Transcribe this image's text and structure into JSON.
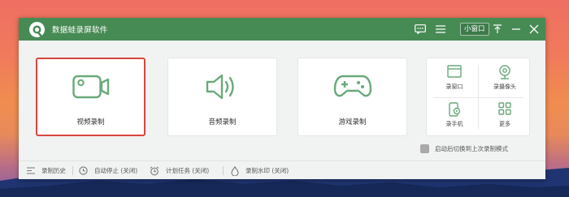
{
  "app": {
    "title": "数据蛙录屏软件"
  },
  "titlebar": {
    "mini_window_label": "小窗口",
    "icons": [
      "message-icon",
      "menu-icon",
      "pin-icon",
      "minimize-icon",
      "close-icon"
    ]
  },
  "modes": [
    {
      "label": "视频录制",
      "icon": "video-camera-icon",
      "selected": true
    },
    {
      "label": "音频录制",
      "icon": "speaker-icon",
      "selected": false
    },
    {
      "label": "游戏录制",
      "icon": "gamepad-icon",
      "selected": false
    }
  ],
  "more_tools": [
    {
      "label": "录窗口",
      "icon": "window-icon"
    },
    {
      "label": "录摄像头",
      "icon": "webcam-icon"
    },
    {
      "label": "录手机",
      "icon": "phone-icon"
    },
    {
      "label": "更多",
      "icon": "grid-icon"
    }
  ],
  "restore_option": {
    "label": "启动后切换到上次录制模式",
    "checked": false
  },
  "bottom_bar": {
    "history": "录制历史",
    "auto_stop": "自动停止 (关闭)",
    "schedule": "计划任务 (关闭)",
    "watermark": "录制水印 (关闭)"
  },
  "colors": {
    "titlebar": "#468b54",
    "accent_green": "#6aa97a",
    "selected_border": "#d9453e"
  }
}
